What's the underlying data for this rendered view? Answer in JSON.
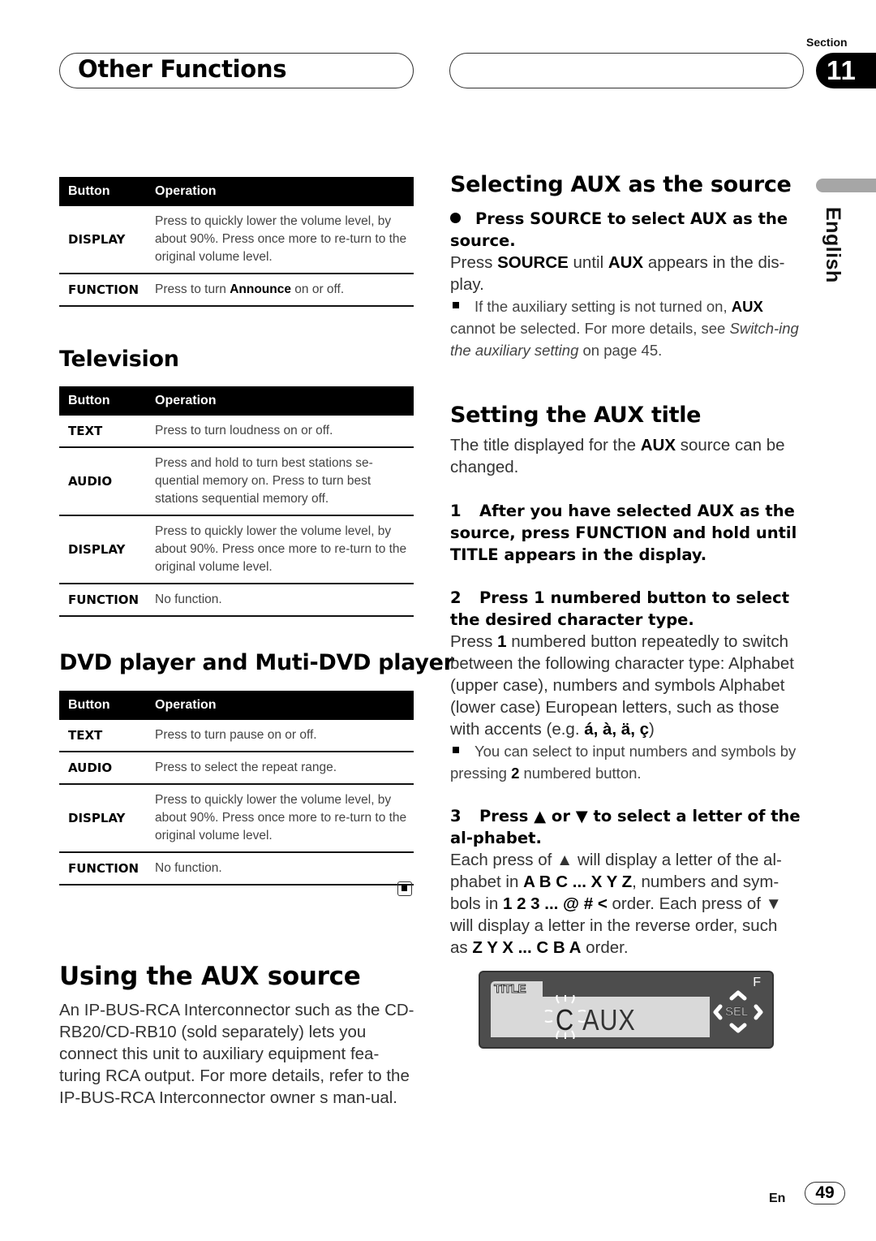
{
  "header": {
    "section_title": "Other Functions",
    "section_label": "Section",
    "section_number": "11",
    "language": "English"
  },
  "table_top": {
    "headers": [
      "Button",
      "Operation"
    ],
    "rows": [
      {
        "button": "DISPLAY",
        "operation": "Press to quickly lower the volume level, by about 90%. Press once more to re-turn to the original volume level."
      },
      {
        "button": "FUNCTION",
        "operation_pre": "Press to turn ",
        "operation_bold": "Announce",
        "operation_post": " on or off."
      }
    ]
  },
  "television": {
    "heading": "Television",
    "headers": [
      "Button",
      "Operation"
    ],
    "rows": [
      {
        "button": "TEXT",
        "operation": "Press to turn loudness on or off."
      },
      {
        "button": "AUDIO",
        "operation": "Press and hold to turn best stations se-quential memory on. Press to turn best stations sequential memory off."
      },
      {
        "button": "DISPLAY",
        "operation": "Press to quickly lower the volume level, by about 90%. Press once more to re-turn to the original volume level."
      },
      {
        "button": "FUNCTION",
        "operation": "No function."
      }
    ]
  },
  "dvd": {
    "heading": "DVD player and Muti-DVD player",
    "headers": [
      "Button",
      "Operation"
    ],
    "rows": [
      {
        "button": "TEXT",
        "operation": "Press to turn pause on or off."
      },
      {
        "button": "AUDIO",
        "operation": "Press to select the repeat range."
      },
      {
        "button": "DISPLAY",
        "operation": "Press to quickly lower the volume level, by about 90%. Press once more to re-turn to the original volume level."
      },
      {
        "button": "FUNCTION",
        "operation": "No function."
      }
    ]
  },
  "using_aux": {
    "heading": "Using the AUX source",
    "body": "An IP-BUS-RCA Interconnector such as the CD-RB20/CD-RB10 (sold separately) lets you connect this unit to auxiliary equipment fea-turing RCA output. For more details, refer to the IP-BUS-RCA Interconnector owner s man-ual."
  },
  "selecting_aux": {
    "heading": "Selecting AUX as the source",
    "step": "Press SOURCE to select AUX as the source.",
    "body_1": "Press ",
    "body_b1": "SOURCE",
    "body_2": " until ",
    "body_b2": "AUX",
    "body_3": " appears in the dis-play.",
    "note_1": "If the auxiliary setting is not turned on, ",
    "note_b": "AUX",
    "note_2": " cannot be selected. For more details, see ",
    "note_i": "Switch-ing the auxiliary setting",
    "note_3": " on page 45."
  },
  "setting_title": {
    "heading": "Setting the AUX title",
    "intro_1": "The title displayed for the ",
    "intro_b": "AUX",
    "intro_2": " source can be changed.",
    "step1_num": "1",
    "step1": "After you have selected AUX as the source, press FUNCTION and hold until TITLE appears in the display.",
    "step2_num": "2",
    "step2": "Press 1 numbered button to select the desired character type.",
    "step2_body_1": "Press ",
    "step2_body_b": "1",
    "step2_body_2": " numbered button repeatedly to switch between the following character type: Alphabet (upper case), numbers and symbols   Alphabet (lower case)   European letters, such as those with accents (e.g. ",
    "step2_body_accents": "á, à, ä, ç",
    "step2_body_3": ")",
    "step2_note_1": "You can select to input numbers and symbols by pressing ",
    "step2_note_b": "2",
    "step2_note_2": " numbered button.",
    "step3_num": "3",
    "step3": "Press ▲ or ▼ to select a letter of the al-phabet.",
    "step3_body_1": "Each press of ▲ will display a letter of the al-phabet in ",
    "step3_body_b1": "A B C ... X Y Z",
    "step3_body_2": ", numbers and sym-bols in ",
    "step3_body_b2": "1 2 3 ... @ # <",
    "step3_body_3": " order. Each press of ▼ will display a letter in the reverse order, such as ",
    "step3_body_b3": "Z Y X ... C B A",
    "step3_body_4": " order."
  },
  "display_illustration": {
    "tab_label": "TITLE",
    "cursor_char": "C",
    "text": "AUX",
    "f_label": "F",
    "sel_label": "SEL"
  },
  "footer": {
    "lang_code": "En",
    "page_number": "49"
  }
}
